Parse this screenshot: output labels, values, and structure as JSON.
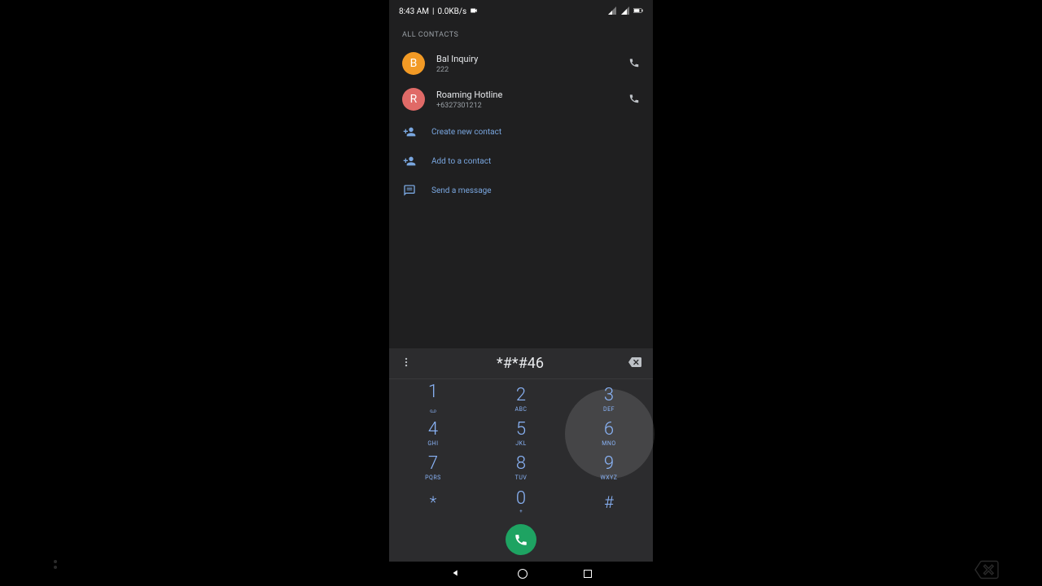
{
  "status": {
    "time": "8:43 AM",
    "data_rate": "0.0KB/s"
  },
  "section_label": "ALL CONTACTS",
  "contacts": [
    {
      "initial": "B",
      "name": "Bal Inquiry",
      "number": "222"
    },
    {
      "initial": "R",
      "name": "Roaming Hotline",
      "number": "+6327301212"
    }
  ],
  "actions": {
    "create": "Create new contact",
    "add": "Add to a contact",
    "message": "Send a message"
  },
  "dialed": "*#*#46",
  "keypad": {
    "k1": {
      "d": "1",
      "l": ""
    },
    "k2": {
      "d": "2",
      "l": "ABC"
    },
    "k3": {
      "d": "3",
      "l": "DEF"
    },
    "k4": {
      "d": "4",
      "l": "GHI"
    },
    "k5": {
      "d": "5",
      "l": "JKL"
    },
    "k6": {
      "d": "6",
      "l": "MNO"
    },
    "k7": {
      "d": "7",
      "l": "PQRS"
    },
    "k8": {
      "d": "8",
      "l": "TUV"
    },
    "k9": {
      "d": "9",
      "l": "WXYZ"
    },
    "kstar": "*",
    "k0": {
      "d": "0",
      "l": "+"
    },
    "khash": "#"
  }
}
